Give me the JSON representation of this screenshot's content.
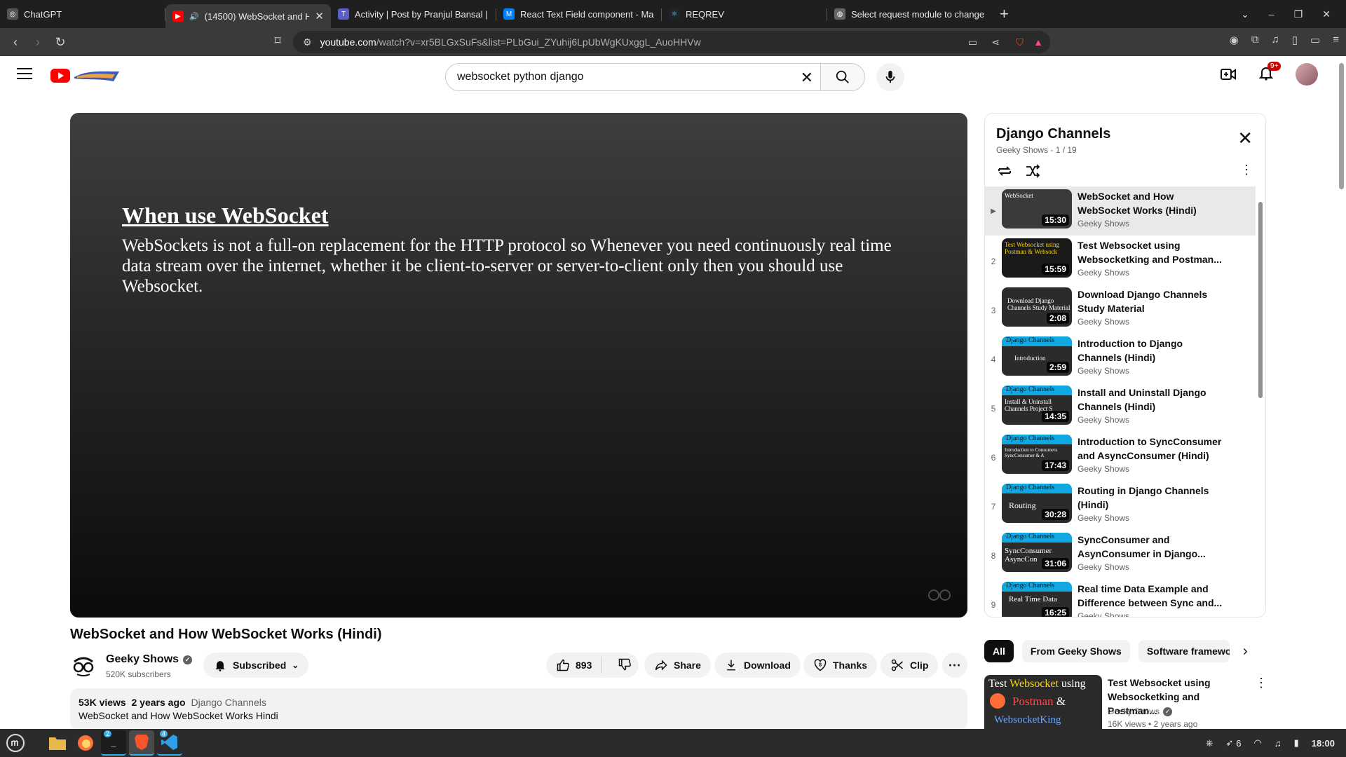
{
  "browser": {
    "tabs": [
      {
        "title": "ChatGPT",
        "favicon_color": "#555555",
        "active": false
      },
      {
        "title": "(14500) WebSocket and H",
        "favicon_color": "#ff0000",
        "active": true,
        "audio": "🔊"
      },
      {
        "title": "Activity | Post by Pranjul Bansal |",
        "favicon_color": "#5b5fc7",
        "active": false
      },
      {
        "title": "React Text Field component - Ma",
        "favicon_color": "#007fff",
        "active": false
      },
      {
        "title": "REQREV",
        "favicon_color": "#61dafb",
        "active": false
      },
      {
        "title": "Select request module to change",
        "favicon_color": "#888888",
        "active": false
      }
    ],
    "url_host": "youtube.com",
    "url_path": "/watch?v=xr5BLGxSuFs&list=PLbGui_ZYuhij6LpUbWgKUxggL_AuoHHVw"
  },
  "masthead": {
    "search_value": "websocket python django",
    "notification_count": "9+"
  },
  "player": {
    "slide_title": "When use WebSocket",
    "slide_body": "WebSockets is not a full-on replacement for the HTTP protocol so Whenever you need continuously real time data stream over the internet, whether it be client-to-server or server-to-client only then you should use Websocket."
  },
  "video": {
    "title": "WebSocket and How WebSocket Works (Hindi)",
    "channel": "Geeky Shows",
    "subscribers": "520K subscribers",
    "subscribe_label": "Subscribed",
    "likes": "893",
    "share_label": "Share",
    "download_label": "Download",
    "thanks_label": "Thanks",
    "clip_label": "Clip",
    "views": "53K views",
    "age": "2 years ago",
    "tag": "Django Channels",
    "description": "WebSocket and How WebSocket Works Hindi"
  },
  "playlist": {
    "title": "Django Channels",
    "subtitle": "Geeky Shows - 1 / 19",
    "items": [
      {
        "index": "▶",
        "title": "WebSocket and How WebSocket Works (Hindi)",
        "channel": "Geeky Shows",
        "duration": "15:30",
        "band": "",
        "thumb_text": "WebSocket",
        "current": true
      },
      {
        "index": "2",
        "title": "Test Websocket using Websocketking and Postman...",
        "channel": "Geeky Shows",
        "duration": "15:59",
        "band": "",
        "thumb_text": "Test Websocket using Postman & Websock",
        "current": false
      },
      {
        "index": "3",
        "title": "Download Django Channels Study Material",
        "channel": "Geeky Shows",
        "duration": "2:08",
        "band": "",
        "thumb_text": "Download Django Channels Study Material",
        "current": false
      },
      {
        "index": "4",
        "title": "Introduction to Django Channels (Hindi)",
        "channel": "Geeky Shows",
        "duration": "2:59",
        "band": "Django Channels",
        "thumb_text": "Introduction",
        "current": false
      },
      {
        "index": "5",
        "title": "Install and Uninstall Django Channels (Hindi)",
        "channel": "Geeky Shows",
        "duration": "14:35",
        "band": "Django Channels",
        "thumb_text": "Install & Uninstall Channels Project S",
        "current": false
      },
      {
        "index": "6",
        "title": "Introduction to SyncConsumer and AsyncConsumer (Hindi)",
        "channel": "Geeky Shows",
        "duration": "17:43",
        "band": "Django Channels",
        "thumb_text": "Introduction to Consumers SyncConsumer & A",
        "current": false
      },
      {
        "index": "7",
        "title": "Routing in Django Channels (Hindi)",
        "channel": "Geeky Shows",
        "duration": "30:28",
        "band": "Django Channels",
        "thumb_text": "Routing",
        "current": false
      },
      {
        "index": "8",
        "title": "SyncConsumer and AsynConsumer in Django...",
        "channel": "Geeky Shows",
        "duration": "31:06",
        "band": "Django Channels",
        "thumb_text": "SyncConsumer AsyncCon",
        "current": false
      },
      {
        "index": "9",
        "title": "Real time Data Example and Difference between Sync and...",
        "channel": "Geeky Shows",
        "duration": "16:25",
        "band": "Django Channels",
        "thumb_text": "Real Time Data",
        "current": false
      }
    ]
  },
  "chips": [
    "All",
    "From Geeky Shows",
    "Software framework"
  ],
  "recommendation": {
    "title": "Test Websocket using Websocketking and Postman...",
    "channel": "Geeky Shows",
    "meta": "16K views • 2 years ago",
    "thumb_line1_a": "Test ",
    "thumb_line1_b": "Websocket",
    "thumb_line1_c": " using",
    "thumb_line2_a": "Postman",
    "thumb_line2_b": " &",
    "thumb_line3": "WebsocketKing"
  },
  "taskbar": {
    "badge_terminal": "2",
    "badge_vscode": "4",
    "tray_count": "6",
    "clock": "18:00"
  }
}
